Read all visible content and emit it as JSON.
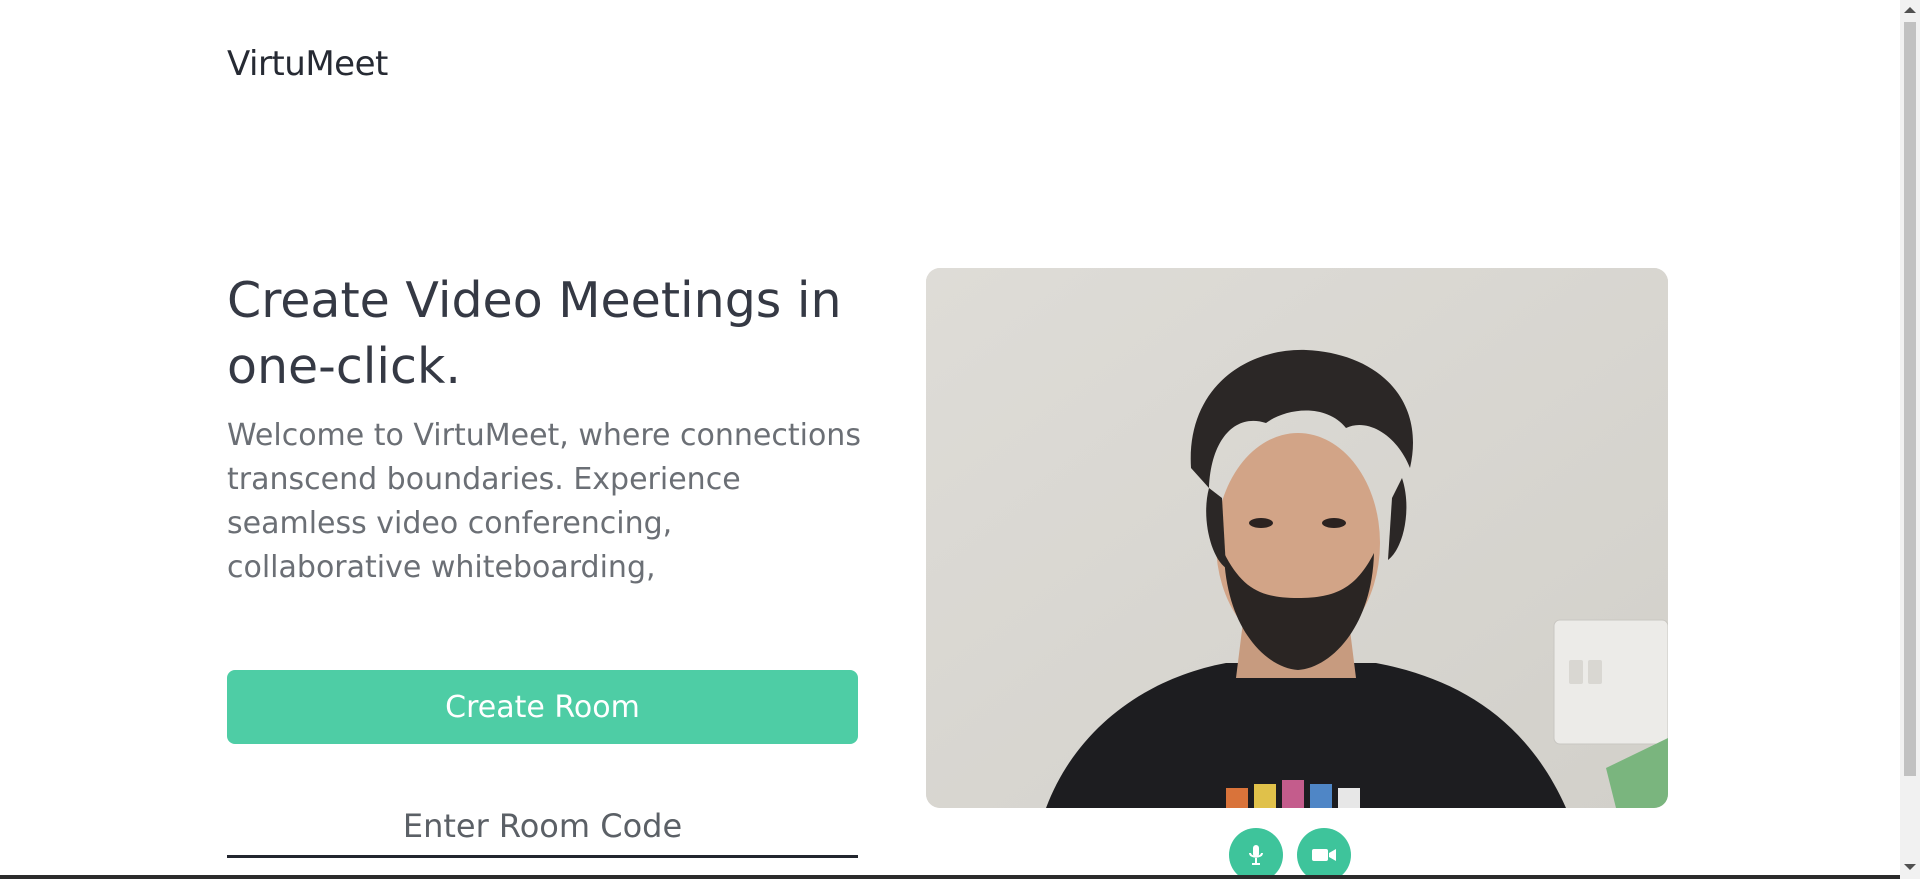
{
  "header": {
    "brand": "VirtuMeet"
  },
  "hero": {
    "headline": "Create Video Meetings in one-click.",
    "description": "Welcome to VirtuMeet, where connections transcend boundaries. Experience seamless video conferencing, collaborative whiteboarding,"
  },
  "actions": {
    "create_room_label": "Create Room",
    "room_code_placeholder": "Enter Room Code",
    "room_code_value": ""
  },
  "preview": {
    "controls": [
      {
        "icon": "microphone-icon"
      },
      {
        "icon": "video-camera-icon"
      }
    ]
  },
  "colors": {
    "accent": "#4ecda5",
    "control_button": "#3ec49b",
    "heading_text": "#353944",
    "body_text": "#6b6f75"
  }
}
